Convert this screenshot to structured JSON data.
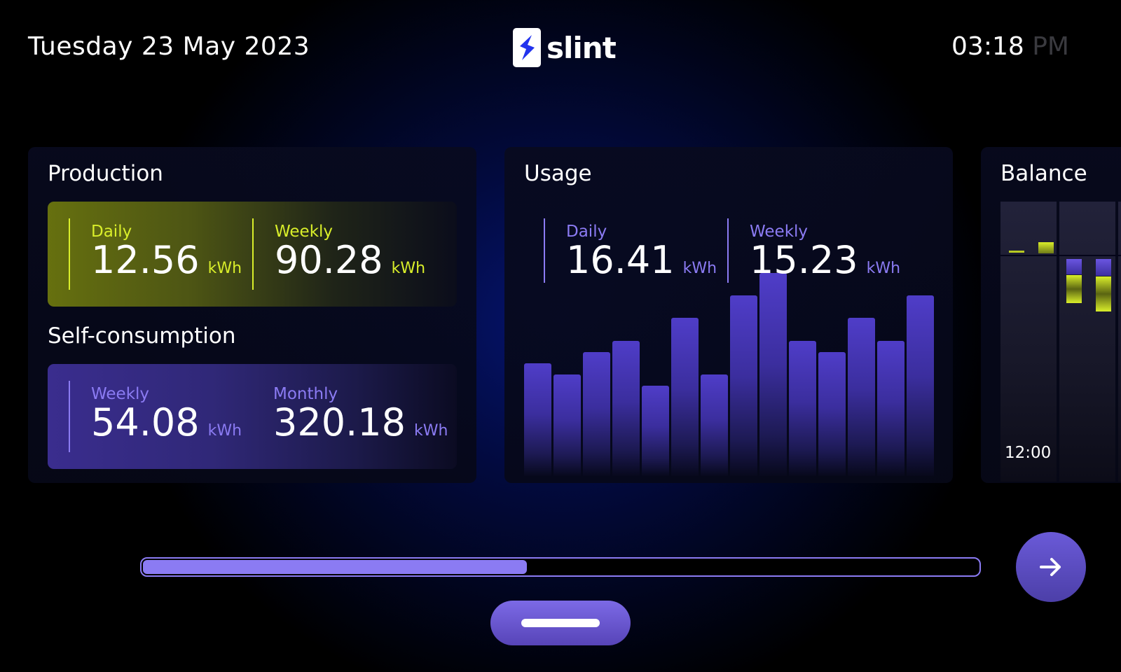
{
  "header": {
    "date": "Tuesday 23 May 2023",
    "logo_text": "slint",
    "time": "03:18",
    "ampm": "PM"
  },
  "production": {
    "title": "Production",
    "daily": {
      "label": "Daily",
      "value": "12.56",
      "unit": "kWh"
    },
    "weekly": {
      "label": "Weekly",
      "value": "90.28",
      "unit": "kWh"
    }
  },
  "self_consumption": {
    "title": "Self-consumption",
    "weekly": {
      "label": "Weekly",
      "value": "54.08",
      "unit": "kWh"
    },
    "monthly": {
      "label": "Monthly",
      "value": "320.18",
      "unit": "kWh"
    }
  },
  "usage": {
    "title": "Usage",
    "daily": {
      "label": "Daily",
      "value": "16.41",
      "unit": "kWh"
    },
    "weekly": {
      "label": "Weekly",
      "value": "15.23",
      "unit": "kWh"
    },
    "bars": [
      5,
      4.5,
      5.5,
      6,
      4,
      7,
      4.5,
      8,
      9,
      6,
      5.5,
      7,
      6,
      8
    ]
  },
  "balance": {
    "title": "Balance",
    "time_label": "12:00"
  },
  "pager": {
    "progress": 0.46
  },
  "colors": {
    "accent_yellow": "#d9ee2a",
    "accent_purple": "#8b7bf3",
    "background": "#000000"
  },
  "icons": {
    "logo": "slint-logo-icon",
    "next": "arrow-right-icon"
  }
}
